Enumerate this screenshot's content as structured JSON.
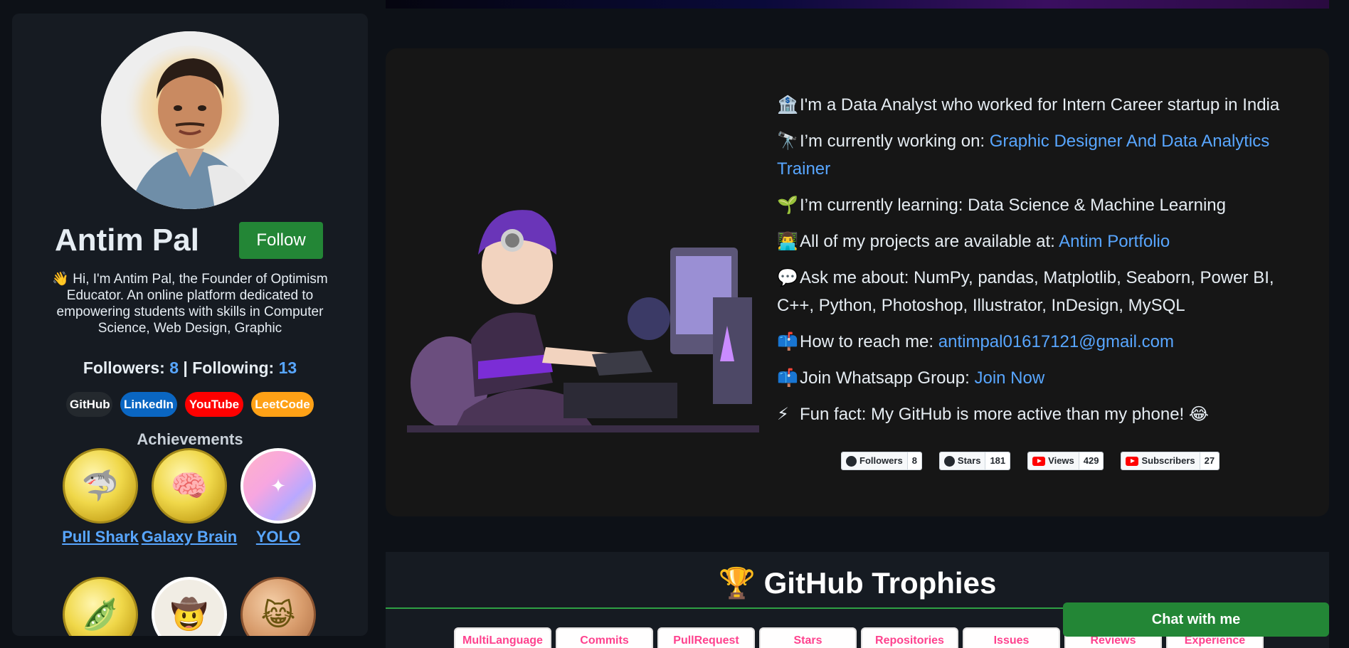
{
  "profile": {
    "name": "Antim Pal",
    "follow_label": "Follow",
    "bio": "👋 Hi, I'm Antim Pal, the Founder of Optimism Educator. An online platform dedicated to empowering students with skills in Computer Science, Web Design, Graphic",
    "followers_label": "Followers:",
    "followers": "8",
    "separator": "|",
    "following_label": "Following:",
    "following": "13"
  },
  "socials": [
    {
      "label": "GitHub",
      "color": "#24292e"
    },
    {
      "label": "LinkedIn",
      "color": "#0a66c2"
    },
    {
      "label": "YouTube",
      "color": "#ff0000"
    },
    {
      "label": "LeetCode",
      "color": "#ffa116"
    }
  ],
  "achievements": {
    "title": "Achievements",
    "badges": [
      {
        "label": "Pull Shark",
        "icon": "shark-badge-icon"
      },
      {
        "label": "Galaxy Brain",
        "icon": "brain-badge-icon"
      },
      {
        "label": "YOLO",
        "icon": "yolo-badge-icon"
      }
    ]
  },
  "about": {
    "line1": {
      "emoji": "🏦",
      "text": "I'm a Data Analyst who worked for Intern Career startup in India"
    },
    "line2": {
      "emoji": "🔭",
      "text": "I’m currently working on: ",
      "link": "Graphic Designer And Data Analytics Trainer"
    },
    "line3": {
      "emoji": "🌱",
      "text": "I’m currently learning: Data Science & Machine Learning"
    },
    "line4": {
      "emoji": "👨‍💻",
      "text": "All of my projects are available at: ",
      "link": "Antim Portfolio"
    },
    "line5": {
      "emoji": "💬",
      "text": "Ask me about: NumPy, pandas, Matplotlib, Seaborn, Power BI, C++, Python, Photoshop, Illustrator, InDesign, MySQL"
    },
    "line6": {
      "emoji": "📫",
      "text": "How to reach me: ",
      "link": "antimpal01617121@gmail.com"
    },
    "line7": {
      "emoji": "📫",
      "text": "Join Whatsapp Group: ",
      "link": "Join Now"
    },
    "line8": {
      "emoji": "⚡",
      "text": "Fun fact: My GitHub is more active than my phone! 😂"
    }
  },
  "stats": [
    {
      "label": "Followers",
      "count": "8",
      "icon": "github-icon"
    },
    {
      "label": "Stars",
      "count": "181",
      "icon": "github-icon"
    },
    {
      "label": "Views",
      "count": "429",
      "icon": "youtube-icon"
    },
    {
      "label": "Subscribers",
      "count": "27",
      "icon": "youtube-icon"
    }
  ],
  "trophies": {
    "title": "🏆 GitHub Trophies",
    "items": [
      "MultiLanguage",
      "Commits",
      "PullRequest",
      "Stars",
      "Repositories",
      "Issues",
      "Reviews",
      "Experience"
    ]
  },
  "chat": {
    "label": "Chat with me"
  },
  "colors": {
    "accent": "#58a6ff",
    "follow_green": "#238636",
    "trophy_pink": "#fe428e"
  }
}
